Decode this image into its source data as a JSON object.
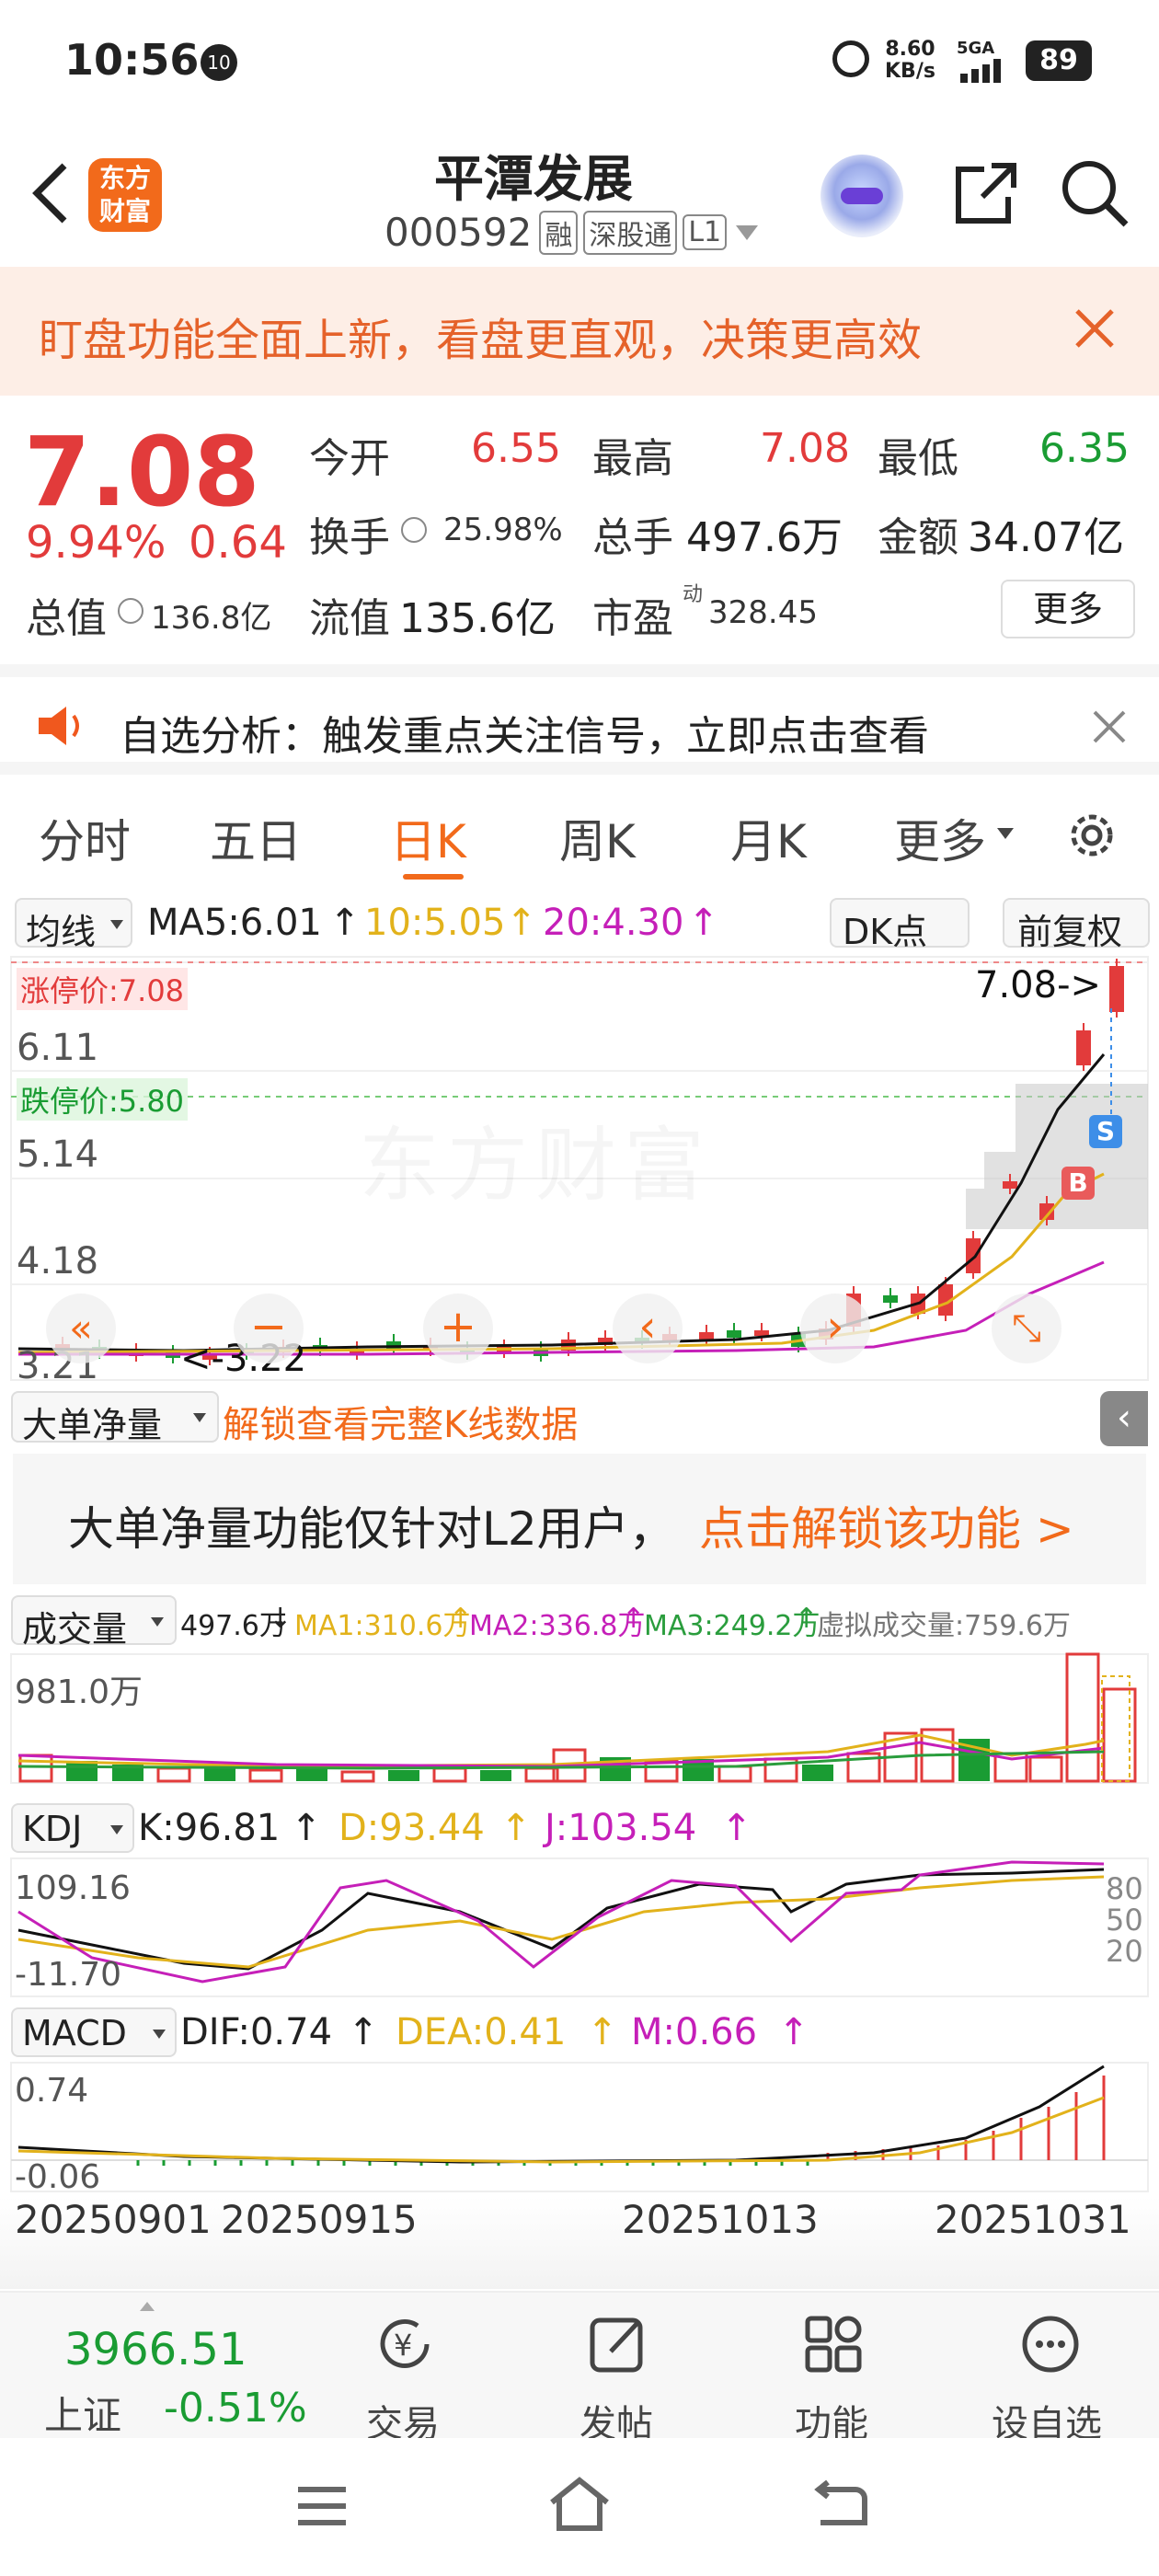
{
  "status_bar": {
    "time": "10:56",
    "notif_badge": "10",
    "net_speed_top": "8.60",
    "net_speed_unit": "KB/s",
    "network": "5GA",
    "battery": "89"
  },
  "header": {
    "title": "平潭发展",
    "code": "000592",
    "tags": [
      "融",
      "深股通",
      "L1"
    ],
    "logo_text": "东方\n财富"
  },
  "banner": {
    "text": "盯盘功能全面上新，看盘更直观，决策更高效"
  },
  "quote": {
    "price": "7.08",
    "pct": "9.94%",
    "change": "0.64",
    "open_label": "今开",
    "open": "6.55",
    "high_label": "最高",
    "high": "7.08",
    "low_label": "最低",
    "low": "6.35",
    "turnover_label": "换手",
    "turnover": "25.98%",
    "volume_label": "总手",
    "volume": "497.6万",
    "amount_label": "金额",
    "amount": "34.07亿",
    "mcap_label": "总值",
    "mcap": "136.8亿",
    "float_label": "流值",
    "float": "135.6亿",
    "pe_label": "市盈",
    "pe_sup": "动",
    "pe": "328.45",
    "more": "更多"
  },
  "alert": {
    "text": "自选分析：触发重点关注信号，立即点击查看"
  },
  "tabs": [
    "分时",
    "五日",
    "日K",
    "周K",
    "月K",
    "更多"
  ],
  "active_tab": "日K",
  "kline": {
    "ma_label": "均线",
    "ma5": "MA5:6.01",
    "ma10": "10:5.05",
    "ma20": "20:4.30",
    "dk_label": "DK点",
    "adjust": "前复权",
    "y_ticks": [
      "6.11",
      "5.14",
      "4.18",
      "3.21"
    ],
    "limit_up": "涨停价:7.08",
    "limit_down": "跌停价:5.80",
    "last_label": "7.08->",
    "low_label": "<-3.22",
    "watermark": "东方财富",
    "markers": [
      "B",
      "S"
    ]
  },
  "big_order": {
    "label": "大单净量",
    "unlock": "解锁查看完整K线数据",
    "notice_text": "大单净量功能仅针对L2用户，",
    "notice_link": "点击解锁该功能 >"
  },
  "volume": {
    "label": "成交量",
    "vol": "497.6万",
    "ma1": "MA1:310.6万",
    "ma2": "MA2:336.8万",
    "ma3": "MA3:249.2万",
    "virtual": "虚拟成交量:759.6万",
    "y_max": "981.0万"
  },
  "kdj": {
    "label": "KDJ",
    "k": "K:96.81",
    "d": "D:93.44",
    "j": "J:103.54",
    "y_top": "109.16",
    "y_bottom": "-11.70",
    "levels": [
      "80",
      "50",
      "20"
    ]
  },
  "macd": {
    "label": "MACD",
    "dif": "DIF:0.74",
    "dea": "DEA:0.41",
    "m": "M:0.66",
    "y_top": "0.74",
    "y_bottom": "-0.06"
  },
  "dates": [
    "20250901",
    "20250915",
    "20251013",
    "20251031"
  ],
  "bottom_nav": {
    "index_value": "3966.51",
    "index_name": "上证",
    "index_change": "-0.51%",
    "items": [
      "交易",
      "发帖",
      "功能",
      "设自选"
    ]
  },
  "colors": {
    "up": "#e23b3b",
    "down": "#1a9c33",
    "accent": "#f26a1b"
  }
}
